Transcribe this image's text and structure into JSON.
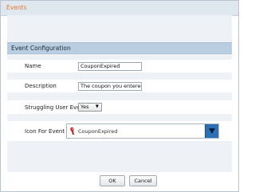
{
  "window": {
    "title": "Events"
  },
  "section": {
    "title": "Event Configuration"
  },
  "fields": {
    "name": {
      "label": "Name",
      "value": "CouponExpired"
    },
    "description": {
      "label": "Description",
      "value": "The coupon you entered"
    },
    "struggling": {
      "label": "Struggling User Event",
      "value": "Yes",
      "caret": "▼"
    },
    "icon": {
      "label": "Icon For Event",
      "value": "CouponExpired",
      "icon": "red-pin-icon"
    }
  },
  "buttons": {
    "ok": "OK",
    "cancel": "Cancel"
  },
  "colors": {
    "title": "#e8772e",
    "section_header": "#b9cee0",
    "dropdown_button": "#2d6fb5",
    "content_bg": "#eef2f6"
  }
}
